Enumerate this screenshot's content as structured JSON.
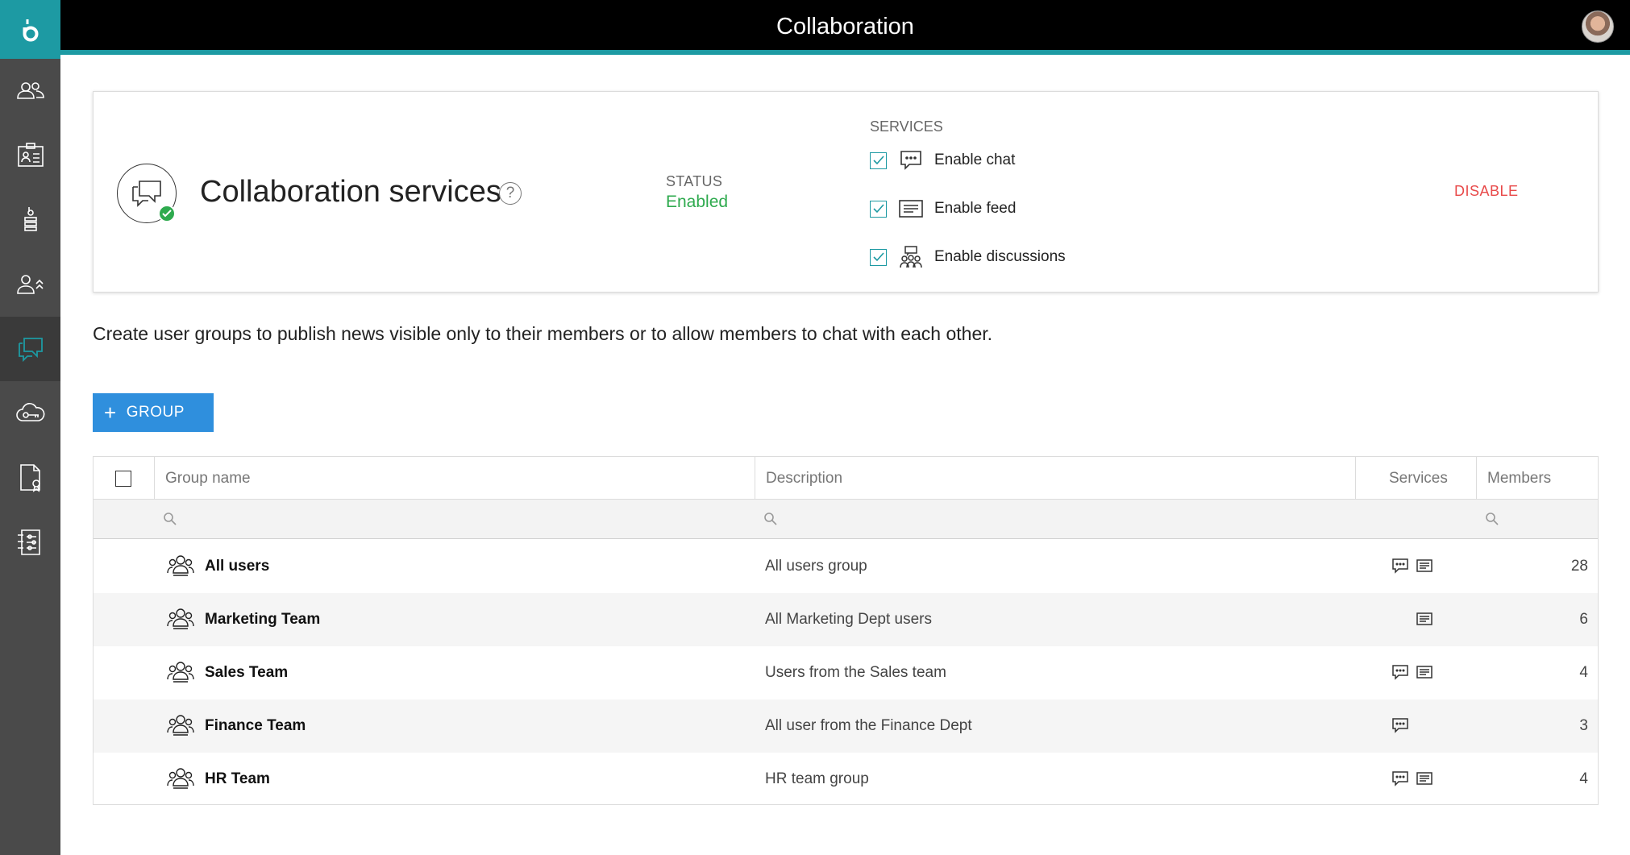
{
  "app": {
    "title": "Collaboration",
    "logo_letter": "b"
  },
  "sidebar": {
    "items": [
      {
        "name": "users-icon"
      },
      {
        "name": "id-card-icon"
      },
      {
        "name": "stack-icon"
      },
      {
        "name": "user-roles-icon"
      },
      {
        "name": "chat-icon",
        "active": true
      },
      {
        "name": "cloud-key-icon"
      },
      {
        "name": "certificate-doc-icon"
      },
      {
        "name": "settings-sliders-icon"
      }
    ]
  },
  "card": {
    "title": "Collaboration services",
    "help": "?",
    "status_label": "STATUS",
    "status_value": "Enabled",
    "services_label": "SERVICES",
    "services": [
      {
        "label": "Enable chat",
        "checked": true,
        "icon": "chat-bubble-icon"
      },
      {
        "label": "Enable feed",
        "checked": true,
        "icon": "feed-icon"
      },
      {
        "label": "Enable discussions",
        "checked": true,
        "icon": "discussions-icon"
      }
    ],
    "disable_label": "DISABLE"
  },
  "intro_text": "Create user groups to publish news visible only to their members or to allow members to chat with each other.",
  "add_button": {
    "plus": "+",
    "label": "GROUP"
  },
  "table": {
    "columns": [
      "Group name",
      "Description",
      "Services",
      "Members"
    ],
    "rows": [
      {
        "name": "All users",
        "description": "All users group",
        "chat": true,
        "feed": true,
        "members": "28"
      },
      {
        "name": "Marketing Team",
        "description": "All Marketing Dept users",
        "chat": false,
        "feed": true,
        "members": "6"
      },
      {
        "name": "Sales Team",
        "description": "Users from the Sales team",
        "chat": true,
        "feed": true,
        "members": "4"
      },
      {
        "name": "Finance Team",
        "description": "All user from the Finance Dept",
        "chat": true,
        "feed": false,
        "members": "3"
      },
      {
        "name": "HR Team",
        "description": "HR team group",
        "chat": true,
        "feed": true,
        "members": "4"
      }
    ]
  },
  "colors": {
    "accent": "#1d9aa3",
    "enabled": "#2eaa4e",
    "disable": "#e84a4a",
    "button": "#2f8fdd"
  }
}
